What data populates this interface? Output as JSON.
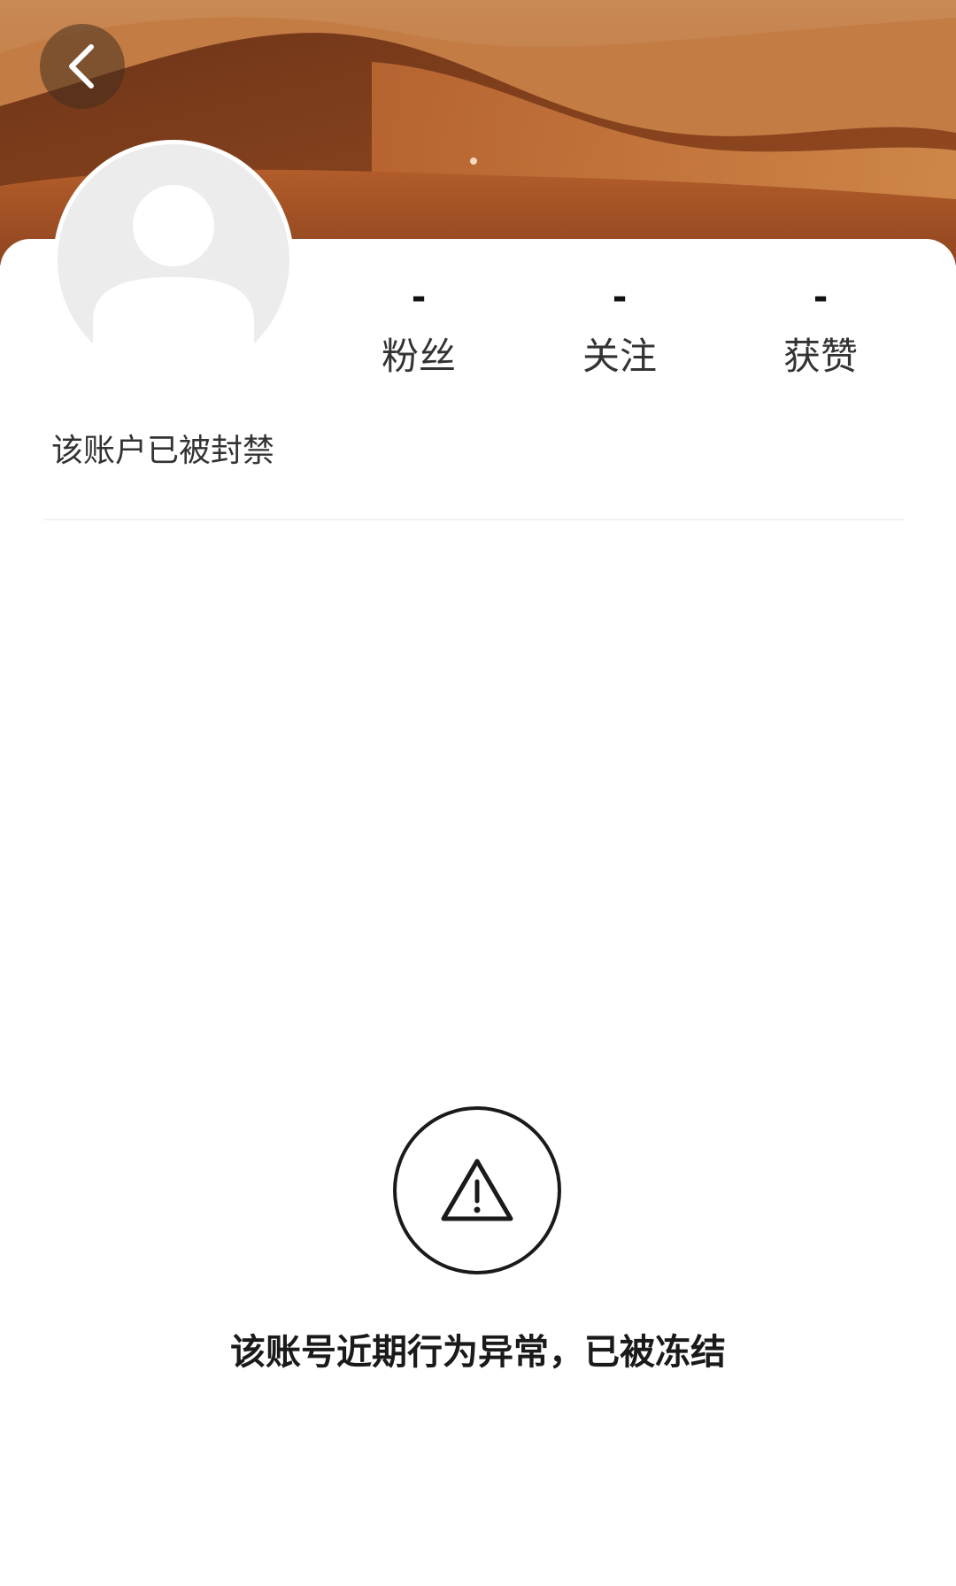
{
  "profile": {
    "stats": [
      {
        "value": "-",
        "label": "粉丝"
      },
      {
        "value": "-",
        "label": "关注"
      },
      {
        "value": "-",
        "label": "获赞"
      }
    ],
    "status_text": "该账户已被封禁"
  },
  "notice": {
    "message": "该账号近期行为异常，已被冻结",
    "icon": "warning-icon"
  },
  "navigation": {
    "back_icon": "chevron-left-icon"
  },
  "colors": {
    "banner": "#b0602e",
    "card": "#ffffff",
    "avatar_placeholder": "#ececec",
    "text": "#333333"
  }
}
